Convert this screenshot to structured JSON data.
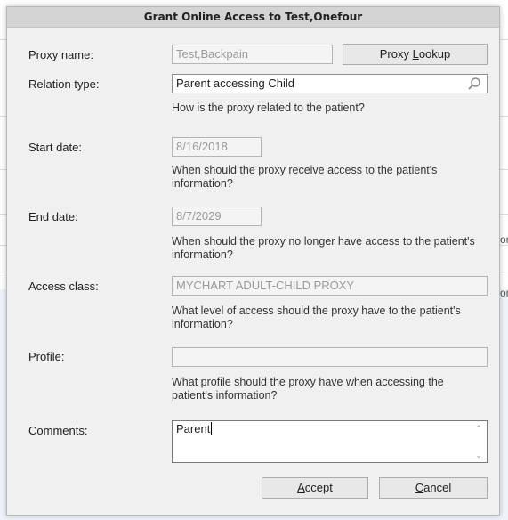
{
  "dialog": {
    "title": "Grant Online Access to Test,Onefour",
    "proxy_name": {
      "label": "Proxy name:",
      "value": "Test,Backpain",
      "lookup_button": "Proxy Lookup"
    },
    "relation_type": {
      "label": "Relation type:",
      "value": "Parent accessing Child",
      "help": "How is the proxy related to the patient?",
      "icon": "search-icon"
    },
    "start_date": {
      "label": "Start date:",
      "value": "8/16/2018",
      "help": "When should the proxy receive access to the patient's information?"
    },
    "end_date": {
      "label": "End date:",
      "value": "8/7/2029",
      "help": "When should the proxy no longer have access to the patient's information?"
    },
    "access_class": {
      "label": "Access class:",
      "value": "MYCHART ADULT-CHILD PROXY",
      "help": "What level of access should the proxy have to the patient's information?"
    },
    "profile": {
      "label": "Profile:",
      "value": "",
      "help": "What profile should the proxy have when accessing the patient's information?"
    },
    "comments": {
      "label": "Comments:",
      "value": "Parent"
    },
    "accept_button": "Accept",
    "cancel_button": "Cancel"
  },
  "background": {
    "fragment_1": "on",
    "fragment_2": "on"
  }
}
